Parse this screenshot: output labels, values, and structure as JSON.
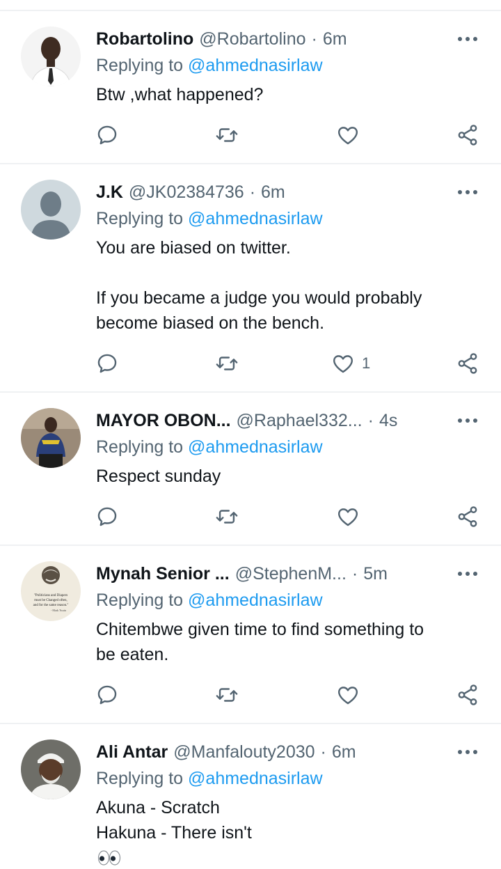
{
  "tweets": [
    {
      "name": "Robartolino",
      "handle": "@Robartolino",
      "separator": "·",
      "time": "6m",
      "replying_prefix": "Replying to",
      "replying_to": "@ahmednasirlaw",
      "text_lines": [
        "Btw ,what happened?"
      ],
      "like_count": "",
      "avatar_icon": "man-in-suit-avatar"
    },
    {
      "name": "J.K",
      "handle": "@JK02384736",
      "separator": "·",
      "time": "6m",
      "replying_prefix": "Replying to",
      "replying_to": "@ahmednasirlaw",
      "text_lines": [
        "You are biased on twitter.",
        "",
        "If you became a judge you would probably",
        "become biased on the bench."
      ],
      "like_count": "1",
      "avatar_icon": "default-profile-avatar"
    },
    {
      "name": "MAYOR OBON...",
      "handle": "@Raphael332...",
      "separator": "·",
      "time": "4s",
      "replying_prefix": "Replying to",
      "replying_to": "@ahmednasirlaw",
      "text_lines": [
        "Respect sunday"
      ],
      "like_count": "",
      "avatar_icon": "man-in-jersey-avatar"
    },
    {
      "name": "Mynah Senior ...",
      "handle": "@StephenM...",
      "separator": "·",
      "time": "5m",
      "replying_prefix": "Replying to",
      "replying_to": "@ahmednasirlaw",
      "text_lines": [
        "Chitembwe given time to find something to",
        "be eaten."
      ],
      "like_count": "",
      "avatar_icon": "mark-twain-quote-avatar",
      "avatar_quote_lines": [
        "\"Politicians and Diapers",
        "must be Changed often,",
        "and for the same reason.\"",
        "- Mark Twain"
      ]
    },
    {
      "name": "Ali Antar",
      "handle": "@Manfalouty2030",
      "separator": "·",
      "time": "6m",
      "replying_prefix": "Replying to",
      "replying_to": "@ahmednasirlaw",
      "text_lines": [
        "Akuna - Scratch",
        "Hakuna - There isn't"
      ],
      "like_count": "",
      "avatar_icon": "man-in-white-cap-avatar",
      "trailing_emoji": "👀"
    }
  ],
  "icons": {
    "more": "more-dots-icon",
    "reply": "reply-bubble-icon",
    "retweet": "retweet-icon",
    "like": "heart-icon",
    "share": "share-icon"
  },
  "colors": {
    "link": "#1d9bf0",
    "muted": "#536471",
    "text": "#0f1419",
    "divider": "#eff1f3"
  }
}
